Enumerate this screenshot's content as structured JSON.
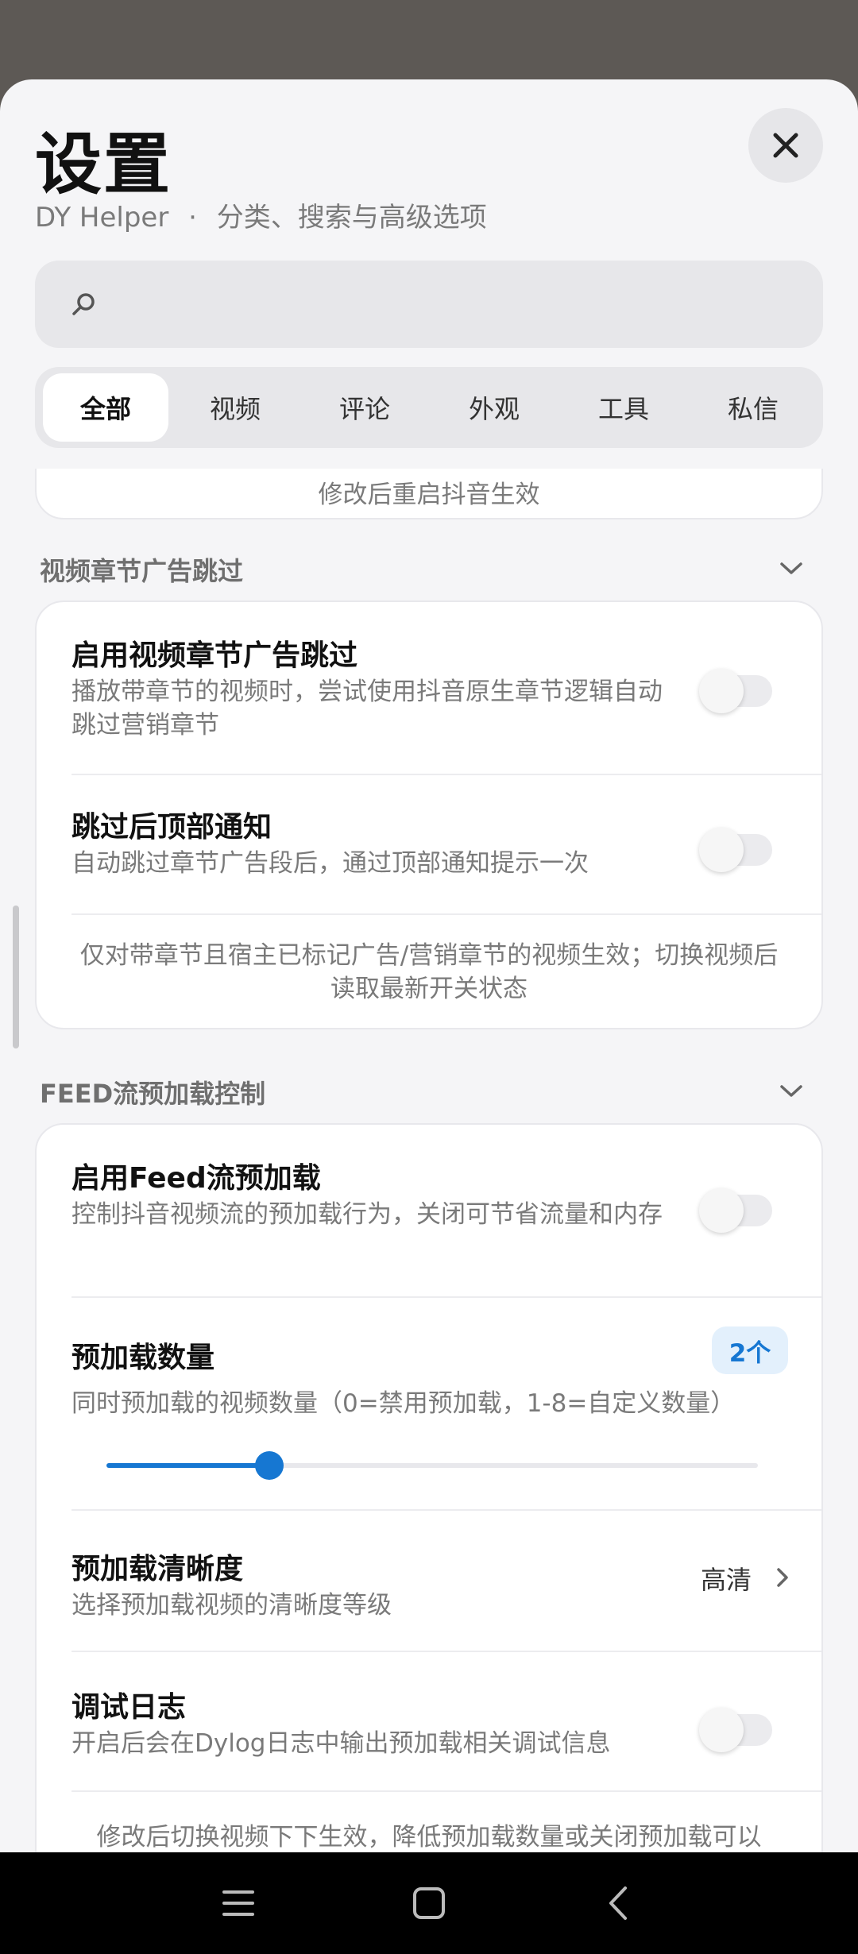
{
  "header": {
    "title": "设置",
    "subtitle_app": "DY Helper",
    "subtitle_sep": "·",
    "subtitle_desc": "分类、搜索与高级选项"
  },
  "search": {
    "placeholder": ""
  },
  "tabs": [
    {
      "label": "全部",
      "active": true
    },
    {
      "label": "视频",
      "active": false
    },
    {
      "label": "评论",
      "active": false
    },
    {
      "label": "外观",
      "active": false
    },
    {
      "label": "工具",
      "active": false
    },
    {
      "label": "私信",
      "active": false
    }
  ],
  "prev_card_note": "修改后重启抖音生效",
  "section_chapter": {
    "header": "视频章节广告跳过",
    "rows": [
      {
        "title": "启用视频章节广告跳过",
        "desc": "播放带章节的视频时，尝试使用抖音原生章节逻辑自动跳过营销章节",
        "enabled": false
      },
      {
        "title": "跳过后顶部通知",
        "desc": "自动跳过章节广告段后，通过顶部通知提示一次",
        "enabled": false
      }
    ],
    "note": "仅对带章节且宿主已标记广告/营销章节的视频生效；切换视频后读取最新开关状态"
  },
  "section_feed": {
    "header": "FEED流预加载控制",
    "enable_row": {
      "title": "启用Feed流预加载",
      "desc": "控制抖音视频流的预加载行为，关闭可节省流量和内存",
      "enabled": false
    },
    "count_row": {
      "title": "预加载数量",
      "badge": "2个",
      "desc": "同时预加载的视频数量（0=禁用预加载，1-8=自定义数量）",
      "value": 2,
      "min": 0,
      "max": 8
    },
    "quality_row": {
      "title": "预加载清晰度",
      "desc": "选择预加载视频的清晰度等级",
      "value": "高清"
    },
    "debug_row": {
      "title": "调试日志",
      "desc": "开启后会在Dylog日志中输出预加载相关调试信息",
      "enabled": false
    },
    "note_partial": "修改后切换视频下下生效，降低预加载数量或关闭预加载可以"
  },
  "colors": {
    "accent": "#1677d2",
    "background": "#f5f5f7",
    "card": "#ffffff"
  },
  "icons": {
    "close": "close-icon",
    "search": "search-icon",
    "chevron": "chevron-down-icon",
    "nav_menu": "menu-icon",
    "nav_home": "home-icon",
    "nav_back": "back-icon"
  }
}
